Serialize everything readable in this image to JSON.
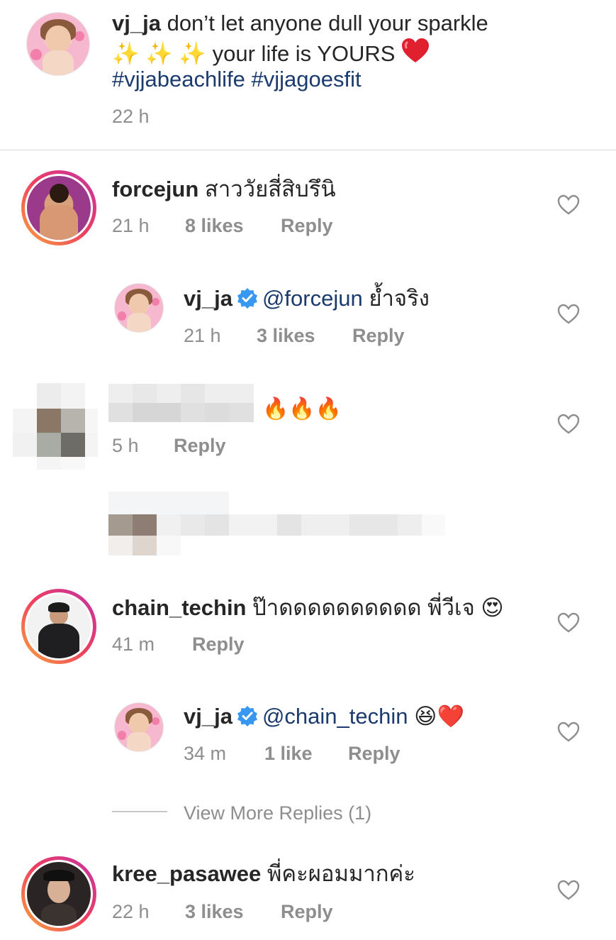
{
  "caption": {
    "username": "vj_ja",
    "text_line1": "don’t let anyone dull your sparkle",
    "text_line2": "✨ ✨ ✨ your life is YOURS",
    "hashtag1": "#vjjabeachlife",
    "hashtag2": "#vjjagoesfit",
    "time": "22 h"
  },
  "comments": [
    {
      "username": "forcejun",
      "text": "สาววัยสี่สิบรึนิ",
      "time": "21 h",
      "likes": "8 likes",
      "reply": "Reply",
      "avatar_icon": "profile-avatar"
    },
    {
      "username": "vj_ja",
      "mention": "@forcejun",
      "text": "ย้ำจริง",
      "time": "21 h",
      "likes": "3 likes",
      "reply": "Reply",
      "verified_icon": "verified-badge-icon"
    },
    {
      "username": "",
      "text": "🔥🔥🔥",
      "time": "5 h",
      "reply": "Reply",
      "note": ""
    },
    {
      "username": "chain_techin",
      "text": "ป๊าดดดดดดดดดด พี่วีเจ",
      "emoji": "😍",
      "time": "41 m",
      "reply": "Reply"
    },
    {
      "username": "vj_ja",
      "mention": "@chain_techin",
      "emoji": "😆❤️",
      "time": "34 m",
      "likes": "1 like",
      "reply": "Reply"
    },
    {
      "username": "kree_pasawee",
      "text": "พี่คะผอมมากค่ะ",
      "time": "22 h",
      "likes": "3 likes",
      "reply": "Reply"
    }
  ],
  "view_more_replies": "View More Replies (1)",
  "colors": {
    "link": "#1b3b6f",
    "muted": "#8e8e8e",
    "text": "#262626",
    "verified": "#3897f0"
  }
}
